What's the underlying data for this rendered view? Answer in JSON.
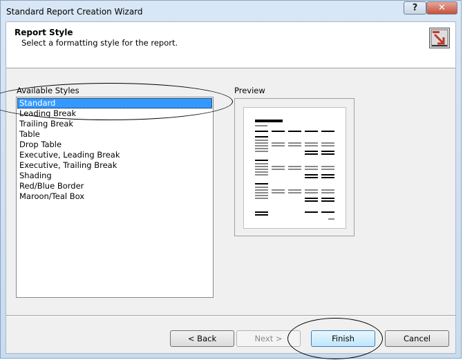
{
  "window": {
    "title": "Standard Report Creation Wizard",
    "help_label": "?",
    "close_label": "✕"
  },
  "header": {
    "title": "Report Style",
    "subtitle": "Select a formatting style for the report.",
    "icon": "report-wizard-icon"
  },
  "styles": {
    "label": "Available Styles",
    "items": [
      {
        "label": "Standard",
        "selected": true
      },
      {
        "label": "Leading Break",
        "selected": false
      },
      {
        "label": "Trailing Break",
        "selected": false
      },
      {
        "label": "Table",
        "selected": false
      },
      {
        "label": "Drop Table",
        "selected": false
      },
      {
        "label": "Executive, Leading Break",
        "selected": false
      },
      {
        "label": "Executive, Trailing Break",
        "selected": false
      },
      {
        "label": "Shading",
        "selected": false
      },
      {
        "label": "Red/Blue Border",
        "selected": false
      },
      {
        "label": "Maroon/Teal Box",
        "selected": false
      }
    ]
  },
  "preview": {
    "label": "Preview"
  },
  "buttons": {
    "back": "< Back",
    "next": "Next >",
    "finish": "Finish",
    "cancel": "Cancel"
  }
}
